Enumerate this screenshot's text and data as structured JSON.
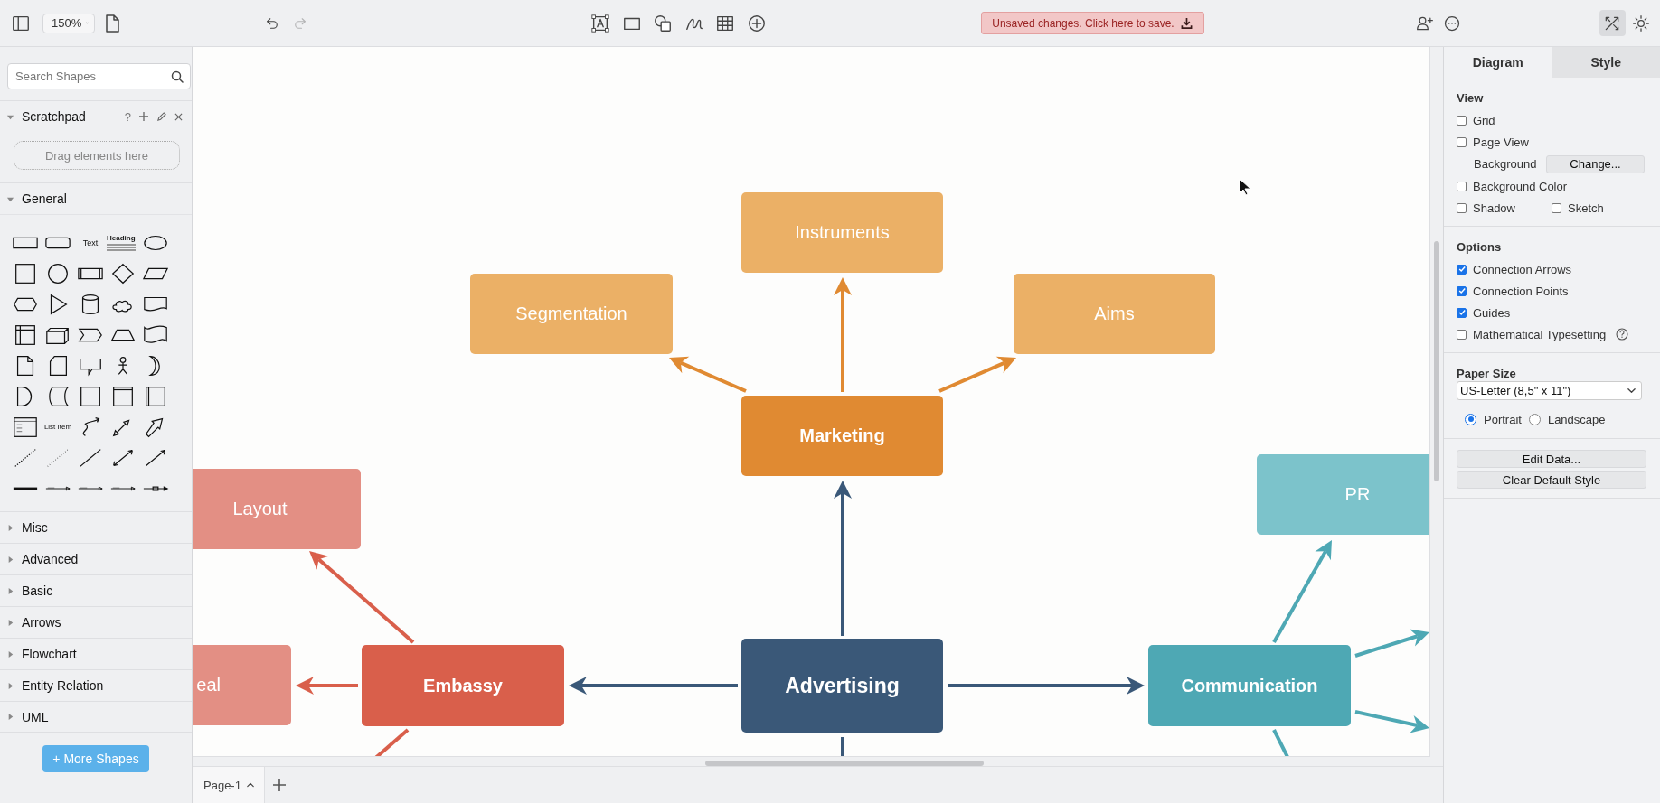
{
  "toolbar": {
    "zoom": "150%",
    "history": [
      {
        "kind": "undo",
        "disabled": false
      },
      {
        "kind": "redo",
        "disabled": true
      }
    ],
    "tools": [
      {
        "kind": "text"
      },
      {
        "kind": "rectangle"
      },
      {
        "kind": "shapes"
      },
      {
        "kind": "freehand"
      },
      {
        "kind": "table"
      },
      {
        "kind": "insert"
      }
    ],
    "save_notice": "Unsaved changes. Click here to save.",
    "right_tools": [
      {
        "kind": "share",
        "selected": false
      },
      {
        "kind": "more",
        "selected": false
      },
      {
        "kind": "format",
        "selected": true
      },
      {
        "kind": "theme",
        "selected": false
      }
    ]
  },
  "sidebar": {
    "search": {
      "placeholder": "Search Shapes"
    },
    "scratchpad": {
      "title": "Scratchpad",
      "expanded": true,
      "help": "?",
      "drop_hint": "Drag elements here"
    },
    "sections": [
      {
        "title": "General",
        "expanded": true,
        "shapes": [
          {
            "kind": "rect"
          },
          {
            "kind": "rounded"
          },
          {
            "kind": "text",
            "label": "Text"
          },
          {
            "kind": "heading",
            "label": "Heading"
          },
          {
            "kind": "ellipse"
          },
          {
            "kind": "square"
          },
          {
            "kind": "circle"
          },
          {
            "kind": "process"
          },
          {
            "kind": "diamond"
          },
          {
            "kind": "parallelogram"
          },
          {
            "kind": "hexagon"
          },
          {
            "kind": "triangle"
          },
          {
            "kind": "cylinder"
          },
          {
            "kind": "cloud"
          },
          {
            "kind": "document"
          },
          {
            "kind": "storage"
          },
          {
            "kind": "cube"
          },
          {
            "kind": "step"
          },
          {
            "kind": "trapezoid"
          },
          {
            "kind": "tape"
          },
          {
            "kind": "note"
          },
          {
            "kind": "card"
          },
          {
            "kind": "callout"
          },
          {
            "kind": "actor"
          },
          {
            "kind": "crescent"
          },
          {
            "kind": "delay"
          },
          {
            "kind": "datastore"
          },
          {
            "kind": "square"
          },
          {
            "kind": "container"
          },
          {
            "kind": "pool"
          },
          {
            "kind": "list"
          },
          {
            "kind": "listitem",
            "label": "List Item"
          },
          {
            "kind": "curve"
          },
          {
            "kind": "bidiarrow"
          },
          {
            "kind": "arrow"
          },
          {
            "kind": "dashed"
          },
          {
            "kind": "dotted"
          },
          {
            "kind": "line"
          },
          {
            "kind": "biline"
          },
          {
            "kind": "dirline"
          },
          {
            "kind": "thick"
          },
          {
            "kind": "link"
          },
          {
            "kind": "link"
          },
          {
            "kind": "link"
          },
          {
            "kind": "boxlink"
          }
        ]
      },
      {
        "title": "Misc",
        "expanded": false
      },
      {
        "title": "Advanced",
        "expanded": false
      },
      {
        "title": "Basic",
        "expanded": false
      },
      {
        "title": "Arrows",
        "expanded": false
      },
      {
        "title": "Flowchart",
        "expanded": false
      },
      {
        "title": "Entity Relation",
        "expanded": false
      },
      {
        "title": "UML",
        "expanded": false
      }
    ],
    "more_button": "+ More Shapes"
  },
  "canvas": {
    "nodes": [
      {
        "label": "Instruments",
        "kind": "sub",
        "color": "#ebb066"
      },
      {
        "label": "Segmentation",
        "kind": "sub",
        "color": "#ebb066"
      },
      {
        "label": "Aims",
        "kind": "sub",
        "color": "#ebb066"
      },
      {
        "label": "Marketing",
        "kind": "main",
        "color": "#e08a32"
      },
      {
        "label": "PR",
        "kind": "sub",
        "color": "#7cc3cb"
      },
      {
        "label": "Layout",
        "kind": "sub",
        "color": "#e38f84"
      },
      {
        "label": "eal",
        "kind": "sub",
        "color": "#e38f84"
      },
      {
        "label": "Embassy",
        "kind": "main",
        "color": "#d95f4b"
      },
      {
        "label": "Advertising",
        "kind": "root",
        "color": "#3a5878"
      },
      {
        "label": "Communication",
        "kind": "main",
        "color": "#4ea8b4"
      }
    ]
  },
  "panel": {
    "tabs": [
      {
        "label": "Diagram",
        "selected": true
      },
      {
        "label": "Style",
        "selected": false
      }
    ],
    "view_title": "View",
    "view": [
      {
        "kind": "checkbox",
        "label": "Grid",
        "checked": false
      },
      {
        "kind": "checkbox",
        "label": "Page View",
        "checked": false
      },
      {
        "kind": "setting",
        "label": "Background",
        "button": "Change..."
      },
      {
        "kind": "checkbox",
        "label": "Background Color",
        "checked": false
      },
      {
        "kind": "pair",
        "items": [
          {
            "label": "Shadow",
            "checked": false
          },
          {
            "label": "Sketch",
            "checked": false
          }
        ]
      }
    ],
    "options_title": "Options",
    "options": [
      {
        "label": "Connection Arrows",
        "checked": true
      },
      {
        "label": "Connection Points",
        "checked": true
      },
      {
        "label": "Guides",
        "checked": true
      },
      {
        "label": "Mathematical Typesetting",
        "checked": false,
        "help": true
      }
    ],
    "paper_title": "Paper Size",
    "paper_size": "US-Letter (8,5\" x 11\")",
    "orientations": [
      {
        "label": "Portrait",
        "selected": true
      },
      {
        "label": "Landscape",
        "selected": false
      }
    ],
    "actions": [
      "Edit Data...",
      "Clear Default Style"
    ]
  },
  "pages": [
    {
      "label": "Page-1",
      "selected": true
    }
  ]
}
